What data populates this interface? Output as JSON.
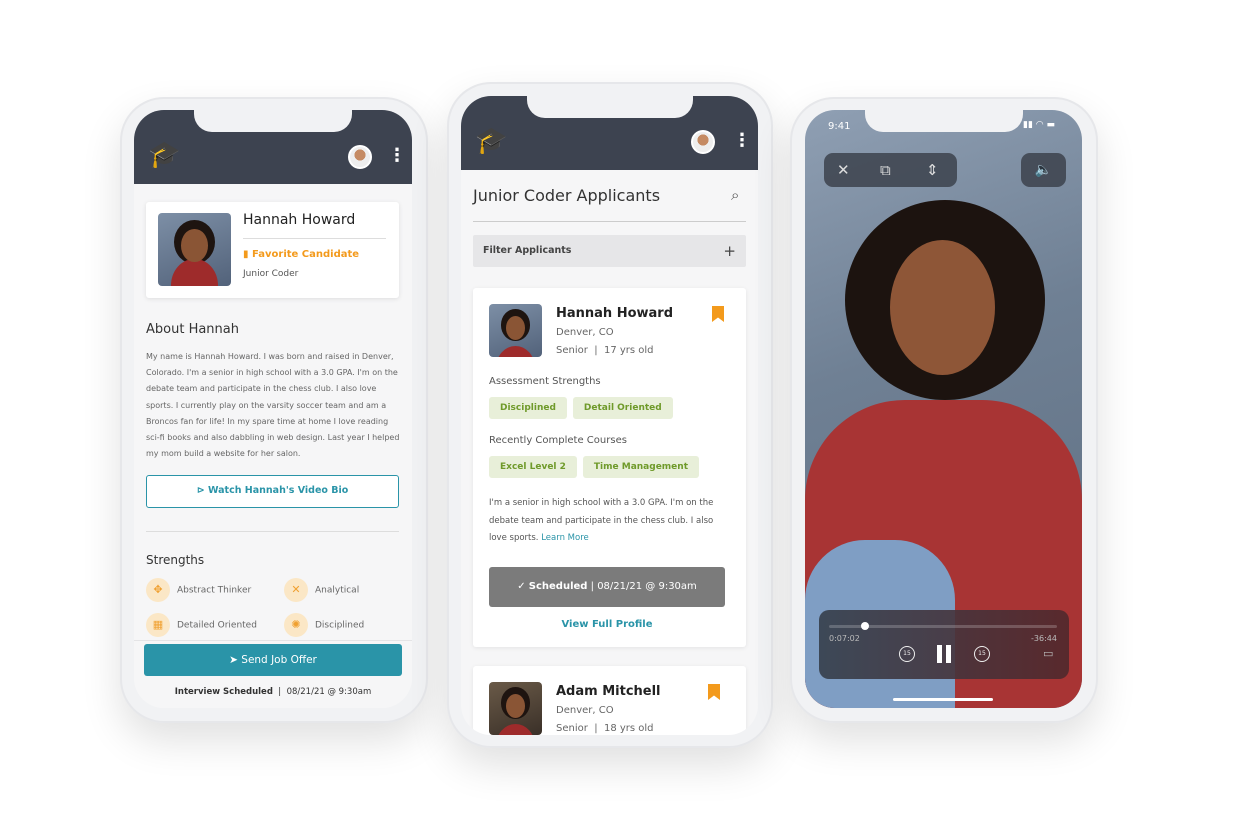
{
  "colors": {
    "header": "#3d4350",
    "accent": "#2a94a8",
    "favorite": "#f39a1c",
    "tag_bg": "#e8efd9",
    "tag_text": "#6f9a2a"
  },
  "profile": {
    "name": "Hannah Howard",
    "favorite": "Favorite Candidate",
    "role": "Junior Coder",
    "about_title": "About Hannah",
    "about_text": "My name is Hannah Howard. I was born and raised in Denver, Colorado. I'm a senior in high school with a 3.0 GPA. I'm on the debate team and participate in the chess club. I also love sports. I currently play on the varsity soccer team and am a Broncos fan for life! In my spare time at home I love reading sci-fi books and also dabbling in web design. Last year I helped my mom build a website for her salon.",
    "video_button": "Watch Hannah's Video Bio",
    "strengths_title": "Strengths",
    "strengths": [
      {
        "label": "Abstract Thinker",
        "icon": "move-icon"
      },
      {
        "label": "Analytical",
        "icon": "strategy-icon"
      },
      {
        "label": "Detailed Oriented",
        "icon": "grid-icon"
      },
      {
        "label": "Disciplined",
        "icon": "target-icon"
      }
    ],
    "send_button": "Send Job Offer",
    "interview_label": "Interview Scheduled",
    "interview_date": "08/21/21 @ 9:30am"
  },
  "applicants": {
    "title": "Junior Coder Applicants",
    "filter": "Filter Applicants",
    "filter_icon": "+",
    "cards": [
      {
        "name": "Hannah Howard",
        "location": "Denver, CO",
        "grade": "Senior",
        "age": "17 yrs old",
        "assessment_title": "Assessment Strengths",
        "assessment": [
          "Disciplined",
          "Detail Oriented"
        ],
        "courses_title": "Recently Complete Courses",
        "courses": [
          "Excel Level 2",
          "Time Management"
        ],
        "bio": "I'm a senior in high school with a 3.0 GPA. I'm on the debate team and participate in the chess club. I also love sports.",
        "learn_more": "Learn More",
        "scheduled_label": "Scheduled",
        "scheduled_date": "08/21/21 @ 9:30am",
        "view_profile": "View Full Profile"
      },
      {
        "name": "Adam Mitchell",
        "location": "Denver, CO",
        "grade": "Senior",
        "age": "18 yrs old"
      }
    ]
  },
  "video": {
    "time": "9:41",
    "elapsed": "0:07:02",
    "remaining": "-36:44",
    "skip": "15",
    "progress": 0.16
  }
}
